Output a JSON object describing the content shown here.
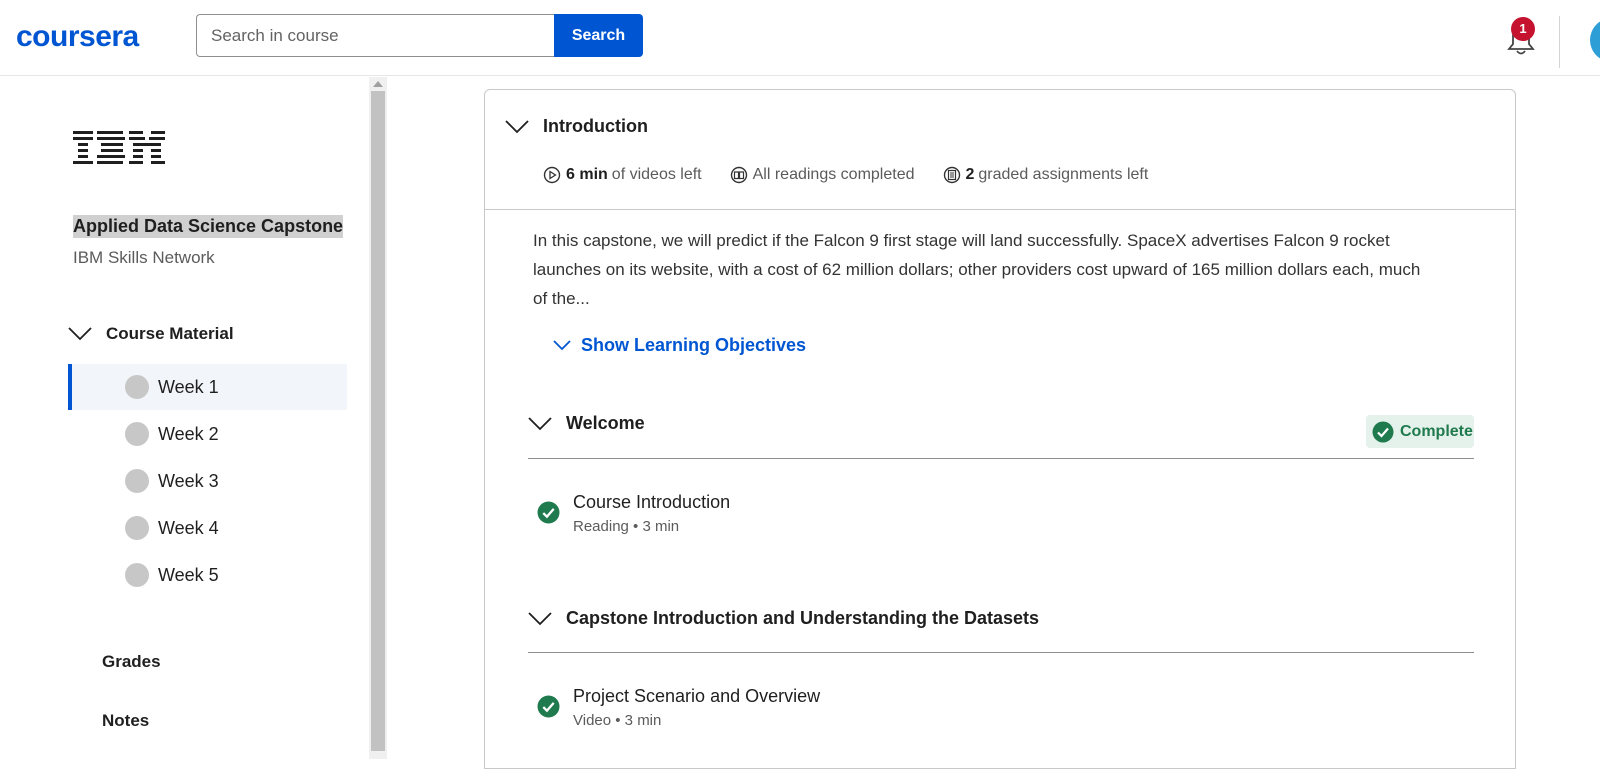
{
  "header": {
    "logo": "coursera",
    "search_placeholder": "Search in course",
    "search_button": "Search",
    "notification_count": "1"
  },
  "sidebar": {
    "provider_logo": "IBM",
    "course_title": "Applied Data Science Capstone",
    "course_org": "IBM Skills Network",
    "course_material_label": "Course Material",
    "weeks": [
      {
        "label": "Week 1",
        "active": true
      },
      {
        "label": "Week 2",
        "active": false
      },
      {
        "label": "Week 3",
        "active": false
      },
      {
        "label": "Week 4",
        "active": false
      },
      {
        "label": "Week 5",
        "active": false
      }
    ],
    "grades_label": "Grades",
    "notes_label": "Notes"
  },
  "main": {
    "module_title": "Introduction",
    "meta": {
      "videos_value": "6 min",
      "videos_text": "of videos left",
      "readings_text": "All readings completed",
      "assignments_value": "2",
      "assignments_text": "graded assignments left"
    },
    "description": "In this capstone, we will predict if the Falcon 9 first stage will land successfully. SpaceX advertises Falcon 9 rocket launches on its website, with a cost of 62 million dollars; other providers cost upward of 165 million dollars each, much of the...",
    "learning_objectives_label": "Show Learning Objectives",
    "sections": [
      {
        "title": "Welcome",
        "status": "Complete",
        "items": [
          {
            "title": "Course Introduction",
            "sub": "Reading • 3 min"
          }
        ]
      },
      {
        "title": "Capstone Introduction and Understanding the Datasets",
        "items": [
          {
            "title": "Project Scenario and Overview",
            "sub": "Video • 3 min"
          }
        ]
      }
    ]
  },
  "colors": {
    "brand": "#0056d2",
    "complete_green": "#1f7a4d",
    "badge_red": "#c4122f"
  }
}
